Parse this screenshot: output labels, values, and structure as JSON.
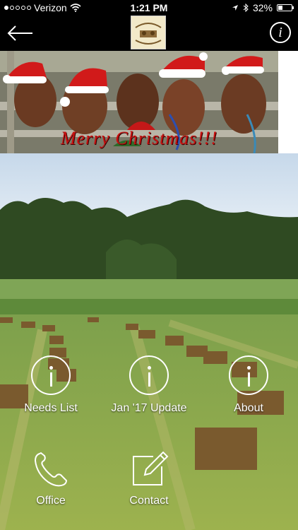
{
  "status_bar": {
    "carrier": "Verizon",
    "time": "1:21 PM",
    "battery": "32%",
    "battery_level": 0.32
  },
  "navbar": {
    "back_icon": "arrow-left-icon",
    "logo_icon": "sunday-christian-youth-ranch-logo",
    "info_icon": "info-icon"
  },
  "banner": {
    "caption": "Merry Christmas!!!"
  },
  "menu": {
    "items": [
      {
        "label": "Needs List",
        "icon": "info-circle-icon"
      },
      {
        "label": "Jan '17 Update",
        "icon": "info-circle-icon"
      },
      {
        "label": "About",
        "icon": "info-circle-icon"
      },
      {
        "label": "Office",
        "icon": "phone-icon"
      },
      {
        "label": "Contact",
        "icon": "compose-icon"
      }
    ]
  },
  "colors": {
    "status_bg": "#000000",
    "banner_text": "#c91010",
    "icon_color": "#ffffff"
  }
}
